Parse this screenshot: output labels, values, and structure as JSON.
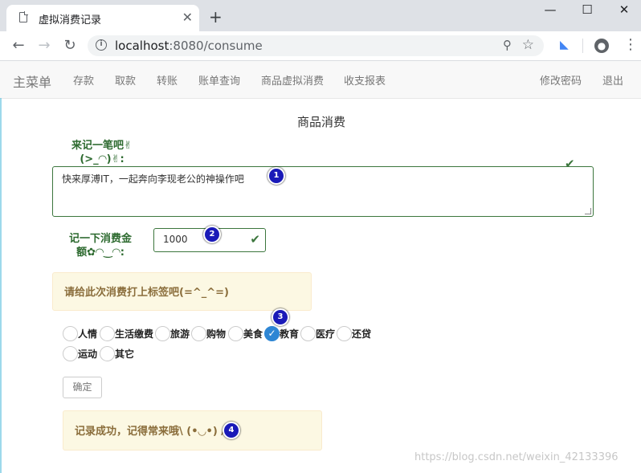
{
  "browser": {
    "tab_title": "虚拟消费记录",
    "tab_close": "✕",
    "new_tab": "+",
    "window_controls": [
      "—",
      "☐",
      "✕"
    ],
    "url_host": "localhost",
    "url_path": ":8080/consume",
    "icons": [
      "document-icon",
      "back-icon",
      "forward-icon",
      "reload-icon",
      "info-icon",
      "zoom-icon",
      "star-icon",
      "extension-icon",
      "account-icon",
      "menu-icon"
    ]
  },
  "navbar": {
    "brand": "主菜单",
    "items": [
      "存款",
      "取款",
      "转账",
      "账单查询",
      "商品虚拟消费",
      "收支报表"
    ],
    "right_items": [
      "修改密码",
      "退出"
    ]
  },
  "page": {
    "title": "商品消费",
    "note_label_1": "来记一笔吧✌",
    "note_label_2": "(>_◠)✌:",
    "note_value": "快来厚溥IT，一起奔向李现老公的神操作吧",
    "amount_label_1": "记一下消费金",
    "amount_label_2": "额✿◠‿◠:",
    "amount_value": "1000",
    "tag_alert": "请给此次消费打上标签吧(=^_^=)",
    "categories": [
      "人情",
      "生活缴费",
      "旅游",
      "购物",
      "美食",
      "教育",
      "医疗",
      "还贷",
      "运动",
      "其它"
    ],
    "selected_category": "教育",
    "submit_label": "确定",
    "success_alert": "记录成功，记得常来哦\\ (•◡•) /"
  },
  "annotations": [
    "1",
    "2",
    "3",
    "4"
  ],
  "watermark": "https://blog.csdn.net/weixin_42133396",
  "colors": {
    "success": "#3c763d",
    "warning_bg": "#fcf8e3",
    "warning_text": "#8a6d3b",
    "badge": "#1a1ab8",
    "radio_checked": "#2e86d4"
  }
}
